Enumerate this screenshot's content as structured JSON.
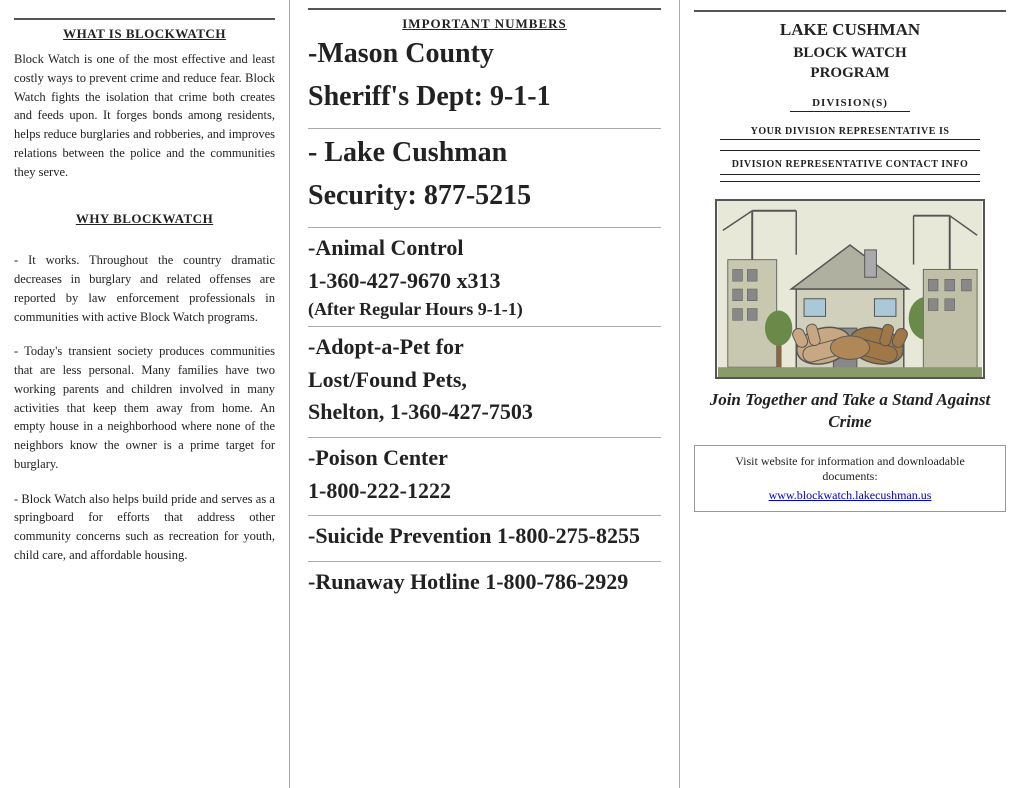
{
  "left": {
    "section1_title": "WHAT IS BLOCKWATCH",
    "section1_body": "Block Watch is one of the most effective and least costly ways to prevent crime and reduce fear.  Block Watch fights the isolation that crime both creates and feeds upon.  It forges bonds among residents, helps reduce burglaries and robberies, and improves relations between the police and the communities they serve.",
    "section2_title": "WHY BLOCKWATCH",
    "section2_body1": "It works.  Throughout the country dramatic decreases in burglary and related offenses are reported by law enforcement professionals in communities with active Block Watch programs.",
    "section2_body2": "Today's transient society produces communities that are less personal.  Many families have two working parents and children involved in many activities that keep them away from home.  An empty house in a neighborhood where none of the neighbors know the owner is a prime target for burglary.",
    "section2_body3": "Block Watch also helps build pride and serves as a springboard for efforts that address other community concerns such as recreation for youth, child care, and affordable housing."
  },
  "middle": {
    "header": "IMPORTANT NUMBERS",
    "entry1": "-Mason County Sheriff's Dept:  9-1-1",
    "entry1_line1": "-Mason County",
    "entry1_line2": "Sheriff's Dept:  9-1-1",
    "entry2_line1": "- Lake Cushman",
    "entry2_line2": "Security:  877-5215",
    "entry3_line1": "-Animal Control",
    "entry3_line2": "1-360-427-9670 x313",
    "entry3_line3": "(After Regular Hours 9-1-1)",
    "entry4_line1": "-Adopt-a-Pet for",
    "entry4_line2": "Lost/Found Pets,",
    "entry4_line3": "Shelton, 1-360-427-7503",
    "entry5_line1": "-Poison Center",
    "entry5_line2": "1-800-222-1222",
    "entry6_line1": "-Suicide Prevention  1-800-275-8255",
    "entry7_line1": "-Runaway Hotline   1-800-786-2929"
  },
  "right": {
    "title1": "LAKE CUSHMAN",
    "title2": "BLOCK WATCH",
    "title3": "PROGRAM",
    "division_label": "DIVISION(S)",
    "rep_label": "YOUR DIVISION REPRESENTATIVE IS",
    "contact_label": "DIVISION REPRESENTATIVE CONTACT INFO",
    "join_text": "Join Together and Take a Stand Against Crime",
    "visit_text1": "Visit website for information and downloadable documents:",
    "visit_link": "www.blockwatch.lakecushman.us"
  }
}
